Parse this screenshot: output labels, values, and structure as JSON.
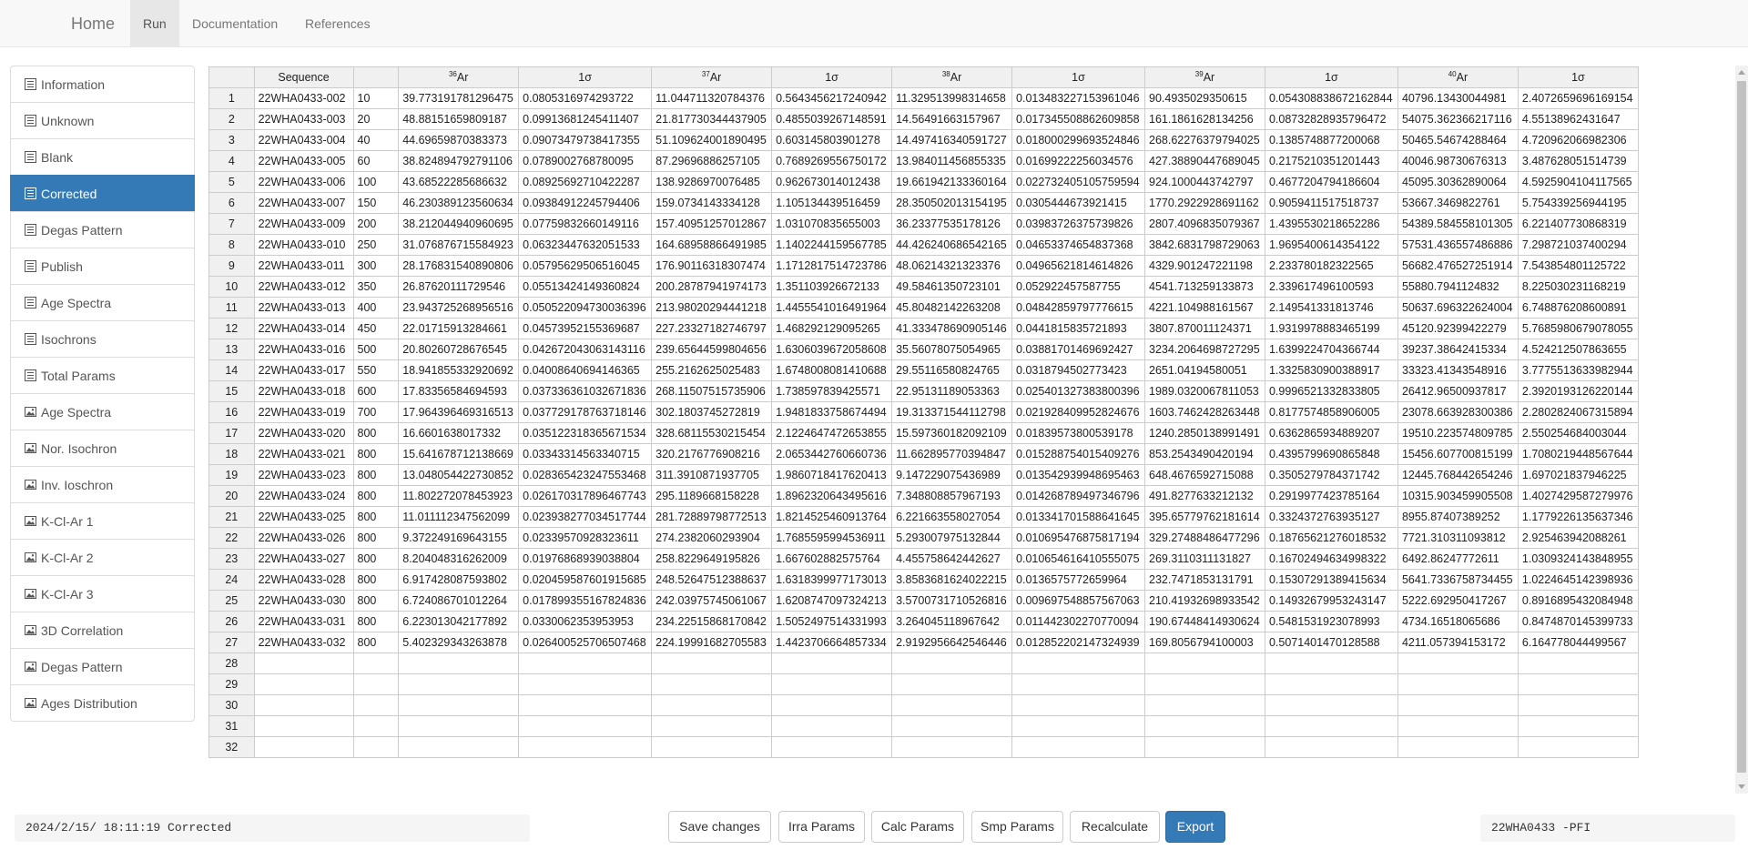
{
  "nav": {
    "brand": "Home",
    "items": [
      "Run",
      "Documentation",
      "References"
    ]
  },
  "sidebar": {
    "items": [
      {
        "label": "Information",
        "icon": "list-icon"
      },
      {
        "label": "Unknown",
        "icon": "list-icon"
      },
      {
        "label": "Blank",
        "icon": "list-icon"
      },
      {
        "label": "Corrected",
        "icon": "list-icon",
        "active": true
      },
      {
        "label": "Degas Pattern",
        "icon": "list-icon"
      },
      {
        "label": "Publish",
        "icon": "list-icon"
      },
      {
        "label": "Age Spectra",
        "icon": "list-icon"
      },
      {
        "label": "Isochrons",
        "icon": "list-icon"
      },
      {
        "label": "Total Params",
        "icon": "list-icon"
      },
      {
        "label": "Age Spectra",
        "icon": "picture-icon"
      },
      {
        "label": "Nor. Isochron",
        "icon": "picture-icon"
      },
      {
        "label": "Inv. Ioschron",
        "icon": "picture-icon"
      },
      {
        "label": "K-Cl-Ar 1",
        "icon": "picture-icon"
      },
      {
        "label": "K-Cl-Ar 2",
        "icon": "picture-icon"
      },
      {
        "label": "K-Cl-Ar 3",
        "icon": "picture-icon"
      },
      {
        "label": "3D Correlation",
        "icon": "picture-icon"
      },
      {
        "label": "Degas Pattern",
        "icon": "picture-icon"
      },
      {
        "label": "Ages Distribution",
        "icon": "picture-icon"
      }
    ]
  },
  "table": {
    "headers": [
      {
        "label": "Sequence"
      },
      {
        "label": ""
      },
      {
        "sup": "36",
        "label": "Ar"
      },
      {
        "label": "1σ"
      },
      {
        "sup": "37",
        "label": "Ar"
      },
      {
        "label": "1σ"
      },
      {
        "sup": "38",
        "label": "Ar"
      },
      {
        "label": "1σ"
      },
      {
        "sup": "39",
        "label": "Ar"
      },
      {
        "label": "1σ"
      },
      {
        "sup": "40",
        "label": "Ar"
      },
      {
        "label": "1σ"
      }
    ],
    "total_rows": 32,
    "rows": [
      [
        "22WHA0433-002",
        "10",
        "39.773191781296475",
        "0.0805316974293722",
        "11.044711320784376",
        "0.5643456217240942",
        "11.329513998314658",
        "0.013483227153961046",
        "90.4935029350615",
        "0.054308838672162844",
        "40796.13430044981",
        "2.4072659696169154"
      ],
      [
        "22WHA0433-003",
        "20",
        "48.88151659809187",
        "0.09913681245411407",
        "21.817730344437905",
        "0.4855039267148591",
        "14.56491663157967",
        "0.017345508862609858",
        "161.1861628134256",
        "0.08732828935796472",
        "54075.362366217116",
        "4.55138962431647"
      ],
      [
        "22WHA0433-004",
        "40",
        "44.69659870383373",
        "0.09073479738417355",
        "51.109624001890495",
        "0.603145803901278",
        "14.497416340591727",
        "0.018000299693524846",
        "268.62276379794025",
        "0.1385748877200068",
        "50465.54674288464",
        "4.720962066982306"
      ],
      [
        "22WHA0433-005",
        "60",
        "38.824894792791106",
        "0.0789002768780095",
        "87.29696886257105",
        "0.7689269556750172",
        "13.984011456855335",
        "0.01699222256034576",
        "427.38890447689045",
        "0.2175210351201443",
        "40046.98730676313",
        "3.487628051514739"
      ],
      [
        "22WHA0433-006",
        "100",
        "43.68522285686632",
        "0.08925692710422287",
        "138.9286970076485",
        "0.962673014012438",
        "19.661942133360164",
        "0.022732405105759594",
        "924.1000443742797",
        "0.4677204794186604",
        "45095.30362890064",
        "4.5925904104117565"
      ],
      [
        "22WHA0433-007",
        "150",
        "46.230389123560634",
        "0.09384912245794406",
        "159.0734143334128",
        "1.105134439516459",
        "28.350502013154195",
        "0.0305444673921415",
        "1770.2922928691162",
        "0.9059411517518737",
        "53667.3469822761",
        "5.754339256944195"
      ],
      [
        "22WHA0433-009",
        "200",
        "38.212044940960695",
        "0.07759832660149116",
        "157.40951257012867",
        "1.031070835655003",
        "36.23377535178126",
        "0.03983726375739826",
        "2807.4096835079367",
        "1.4395530218652286",
        "54389.584558101305",
        "6.221407730868319"
      ],
      [
        "22WHA0433-010",
        "250",
        "31.076876715584923",
        "0.06323447632051533",
        "164.68958866491985",
        "1.1402244159567785",
        "44.426240686542165",
        "0.04653374654837368",
        "3842.6831798729063",
        "1.9695400614354122",
        "57531.436557486886",
        "7.298721037400294"
      ],
      [
        "22WHA0433-011",
        "300",
        "28.176831540890806",
        "0.05795629506516045",
        "176.90116318307474",
        "1.1712817514723786",
        "48.06214321323376",
        "0.04965621814614826",
        "4329.901247221198",
        "2.233780182322565",
        "56682.476527251914",
        "7.543854801125722"
      ],
      [
        "22WHA0433-012",
        "350",
        "26.87620111729546",
        "0.05513424149360824",
        "200.28787941974173",
        "1.351103926672133",
        "49.58461350723101",
        "0.052922457587755",
        "4541.713259133873",
        "2.339617496100593",
        "55880.7941124832",
        "8.225030231168219"
      ],
      [
        "22WHA0433-013",
        "400",
        "23.943725268956516",
        "0.050522094730036396",
        "213.98020294441218",
        "1.4455541016491964",
        "45.80482142263208",
        "0.04842859797776615",
        "4221.104988161567",
        "2.149541331813746",
        "50637.696322624004",
        "6.748876208600891"
      ],
      [
        "22WHA0433-014",
        "450",
        "22.017159132846​61",
        "0.04573952155369687",
        "227.23327182746797",
        "1.468292129095265",
        "41.333478690905146",
        "0.0441815835721893",
        "3807.870011124371",
        "1.9319978883465199",
        "45120.92399422279",
        "5.7685980679078055"
      ],
      [
        "22WHA0433-016",
        "500",
        "20.80260728676545",
        "0.042672043063143116",
        "239.65644599804656",
        "1.6306039672058608",
        "35.56078075054965",
        "0.03881701469692427",
        "3234.2064698727295",
        "1.6399224704366744",
        "39237.38642415334",
        "4.524212507863655"
      ],
      [
        "22WHA0433-017",
        "550",
        "18.941855332920692",
        "0.04008640694146365",
        "255.2162625025483",
        "1.6748008081410688",
        "29.55116580824765",
        "0.0318794502773423",
        "2651.04194580051",
        "1.3325830900388917",
        "33323.41343548916",
        "3.7775513633982944"
      ],
      [
        "22WHA0433-018",
        "600",
        "17.83356584694593",
        "0.037336361032671836",
        "268.11507515735906",
        "1.738597839425571",
        "22.95131189053363",
        "0.025401327383800396",
        "1989.0320067811053",
        "0.9996521332833805",
        "26412.96500937817",
        "2.3920193126220144"
      ],
      [
        "22WHA0433-019",
        "700",
        "17.964396469316513",
        "0.037729178763718146",
        "302.1803745272819",
        "1.9481833758674494",
        "19.313371544112798",
        "0.021928409952824676",
        "1603.7462428263448",
        "0.8177574858906005",
        "23078.663928300386",
        "2.2802824067315894"
      ],
      [
        "22WHA0433-020",
        "800",
        "16.660163801733​2",
        "0.035122318365671534",
        "328.68115530215454",
        "2.1224647472653855",
        "15.597360182092109",
        "0.01839573800539178",
        "1240.2850138991491",
        "0.6362865934889207",
        "19510.223574809785",
        "2.550254684003044"
      ],
      [
        "22WHA0433-021",
        "800",
        "15.641678712138669",
        "0.03343314563340715",
        "320.2176776908216",
        "2.0653442760660736",
        "11.662895770394847",
        "0.015288754015409276",
        "853.2543490420194",
        "0.4395799690865848",
        "15456.607700815199",
        "1.7080219448567644"
      ],
      [
        "22WHA0433-023",
        "800",
        "13.048054422730852",
        "0.028365423247553468",
        "311.3910871937705",
        "1.9860718417620413",
        "9.147229075436989",
        "0.013542939948695463",
        "648.4676592715088",
        "0.3505279784371742",
        "12445.768442654246",
        "1.697021837946225"
      ],
      [
        "22WHA0433-024",
        "800",
        "11.802272078453923",
        "0.026170317896467743",
        "295.1189668158228",
        "1.8962320643495616",
        "7.348808857967193",
        "0.014268789497346796",
        "491.8277633212132",
        "0.2919977423785164",
        "10315.903459905508",
        "1.4027429587279976"
      ],
      [
        "22WHA0433-025",
        "800",
        "11.011112347562099",
        "0.023938277034517744",
        "281.72889798772513",
        "1.8214525460913764",
        "6.221663558027054",
        "0.013341701588641645",
        "395.65779762181614",
        "0.3324372763935127",
        "8955.87407389252",
        "1.1779226135637346"
      ],
      [
        "22WHA0433-026",
        "800",
        "9.372249169643155",
        "0.023395709283236​11",
        "274.2382060293904",
        "1.7685595994536911",
        "5.293007975132844",
        "0.010695476875817194",
        "329.27488486477296",
        "0.18765621276018532",
        "7721.310311093812",
        "2.925463942088261"
      ],
      [
        "22WHA0433-027",
        "800",
        "8.204048316262009",
        "0.01976868939038804",
        "258.8229649195826",
        "1.667602882575764",
        "4.455758642442627",
        "0.010654616410555075",
        "269.3110311131827",
        "0.16702494634998322",
        "6492.86247772611",
        "1.0309324143848955"
      ],
      [
        "22WHA0433-028",
        "800",
        "6.917428087593802",
        "0.020459587601915685",
        "248.52647512388637",
        "1.6318399977173013",
        "3.8583681624022215",
        "0.0136575772659964",
        "232.7471853131791",
        "0.15307291389415634",
        "5641.7336758734455",
        "1.0224645142398936"
      ],
      [
        "22WHA0433-030",
        "800",
        "6.724086701012264",
        "0.017899355167824836",
        "242.03975745061067",
        "1.6208747097324213",
        "3.5700731710526816",
        "0.009697548857567063",
        "210.41932698933542",
        "0.14932679953243147",
        "5222.692950417267",
        "0.8916895432084948"
      ],
      [
        "22WHA0433-031",
        "800",
        "6.223013042177892",
        "0.0330062353953953",
        "234.22515868170842",
        "1.5052497514331993",
        "3.264045118967642",
        "0.011442302270770094",
        "190.67448414930624",
        "0.5481531923078993",
        "4734.16518065686",
        "0.8474870145399733"
      ],
      [
        "22WHA0433-032",
        "800",
        "5.402329343263878",
        "0.026400525706507468",
        "224.19991682705583",
        "1.4423706664857334",
        "2.9192956642546446",
        "0.012852202147324939",
        "169.8056794100003",
        "0.5071401470128588",
        "4211.057394153172",
        "6.164778044499567"
      ]
    ]
  },
  "footer": {
    "status_left": "2024/2/15/ 18:11:19 Corrected",
    "status_right": "22WHA0433 -PFI",
    "buttons": {
      "save": "Save changes",
      "irra": "Irra Params",
      "calc": "Calc Params",
      "smp": "Smp Params",
      "recalc": "Recalculate",
      "export": "Export"
    }
  }
}
